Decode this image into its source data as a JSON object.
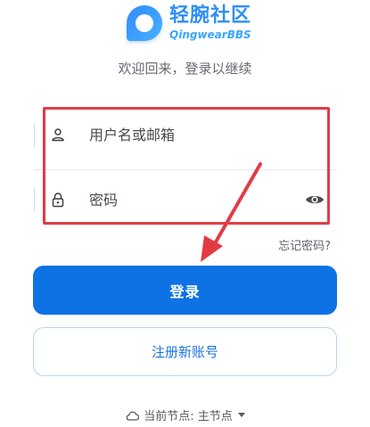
{
  "logo": {
    "title": "轻腕社区",
    "subtitle": "QingwearBBS"
  },
  "subtitle": "欢迎回来，登录以继续",
  "form": {
    "username_placeholder": "用户名或邮箱",
    "password_placeholder": "密码",
    "forgot_password": "忘记密码?"
  },
  "buttons": {
    "login": "登录",
    "register": "注册新账号"
  },
  "node": {
    "label": "当前节点: 主节点"
  },
  "colors": {
    "primary": "#0d72e4",
    "annotation": "#e33b45"
  }
}
